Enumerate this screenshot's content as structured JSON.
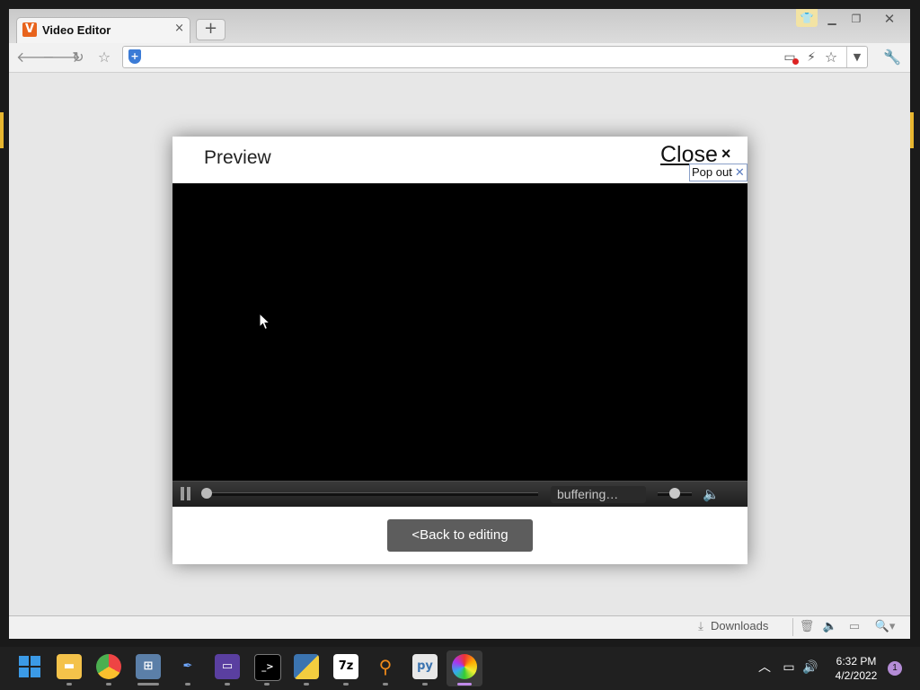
{
  "browser": {
    "tab_title": "Video Editor",
    "tab_favicon": "V",
    "tab_close": "×",
    "new_tab": "+",
    "window_controls": [
      "minimize-icon",
      "restore-icon",
      "close-icon"
    ],
    "nav_icons": [
      "back-arrow-icon",
      "forward-arrow-icon",
      "reload-icon",
      "bookmark-star-icon"
    ],
    "address_bar_value": "",
    "extension_icons": [
      "screen-cast-icon",
      "lightning-icon",
      "star-icon",
      "dropdown-icon"
    ],
    "menu_icon": "wrench-icon"
  },
  "modal": {
    "title": "Preview",
    "close_label": "Close",
    "close_icon": "×",
    "popout_label": "Pop out",
    "popout_close": "✕",
    "player": {
      "state": "paused",
      "status_text": "buffering…",
      "progress": 0.0,
      "volume": 0.5
    },
    "back_button_label": "<Back to editing"
  },
  "download_bar": {
    "label": "Downloads",
    "icons": [
      "trash-icon",
      "speaker-icon",
      "window-icon",
      "zoom-icon"
    ]
  },
  "taskbar": {
    "apps": [
      "start-icon",
      "file-explorer-icon",
      "chrome-icon",
      "network-app-icon",
      "pen-icon",
      "vr-app-icon",
      "terminal-icon",
      "python-icon",
      "7zip-icon",
      "search-tool-icon",
      "python-file-icon",
      "color-wheel-app-icon"
    ],
    "time": "6:32 PM",
    "date": "4/2/2022",
    "notification_count": "1"
  },
  "colors": {
    "favicon": "#e8631c",
    "back_button": "#5d5d5d",
    "player_bg": "#000000",
    "taskbar": "#202020"
  }
}
